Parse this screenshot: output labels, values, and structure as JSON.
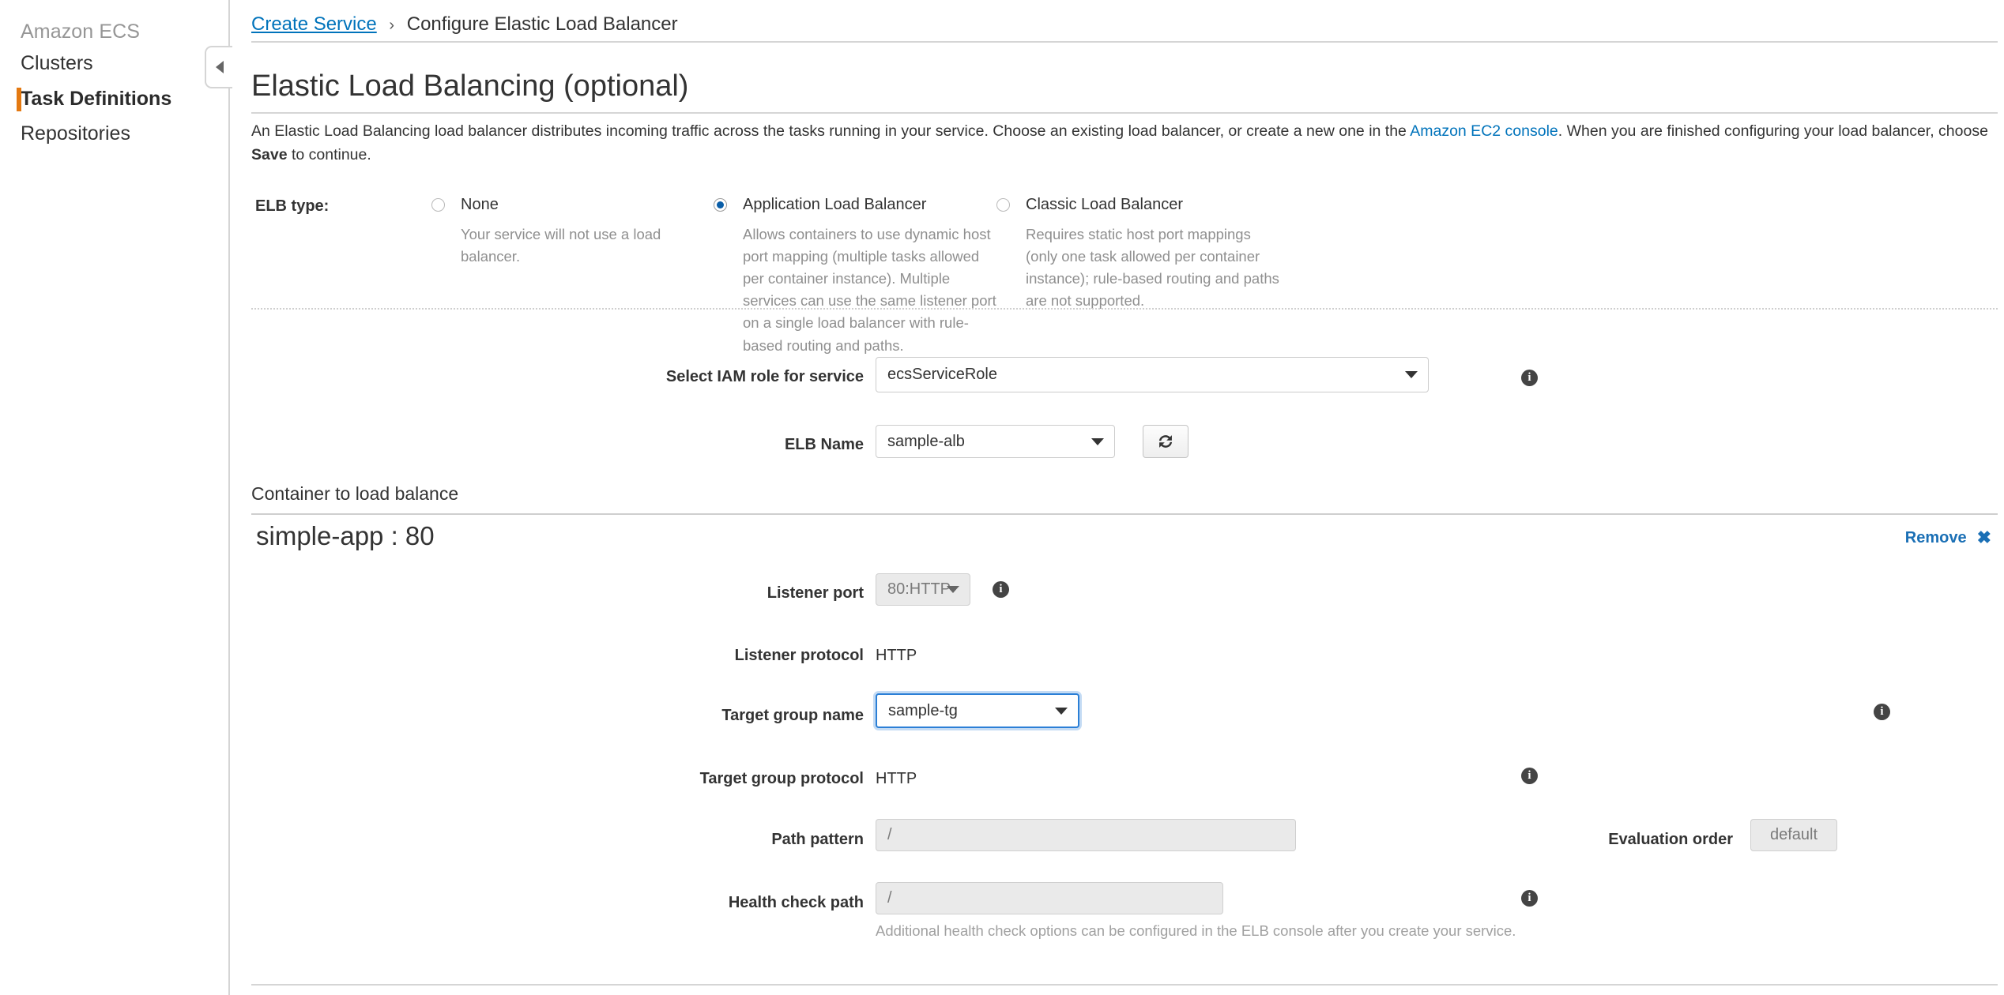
{
  "sidebar": {
    "title": "Amazon ECS",
    "items": [
      {
        "label": "Clusters",
        "active": false
      },
      {
        "label": "Task Definitions",
        "active": true
      },
      {
        "label": "Repositories",
        "active": false
      }
    ],
    "collapse_icon": "chevron-left-icon"
  },
  "breadcrumb": {
    "link": "Create Service",
    "separator": "›",
    "current": "Configure Elastic Load Balancer"
  },
  "page": {
    "heading": "Elastic Load Balancing (optional)",
    "intro_1": "An Elastic Load Balancing load balancer distributes incoming traffic across the tasks running in your service. Choose an existing load balancer, or create a new one in the ",
    "intro_link": "Amazon EC2 console",
    "intro_2": ". When you are finished configuring your load balancer, choose ",
    "intro_bold": "Save",
    "intro_3": " to continue."
  },
  "elb_type": {
    "label": "ELB type:",
    "options": [
      {
        "label": "None",
        "description": "Your service will not use a load balancer.",
        "selected": false
      },
      {
        "label": "Application Load Balancer",
        "description": "Allows containers to use dynamic host port mapping (multiple tasks allowed per container instance). Multiple services can use the same listener port on a single load balancer with rule-based routing and paths.",
        "selected": true
      },
      {
        "label": "Classic Load Balancer",
        "description": "Requires static host port mappings (only one task allowed per container instance); rule-based routing and paths are not supported.",
        "selected": false
      }
    ]
  },
  "form": {
    "iam_role": {
      "label": "Select IAM role for service",
      "value": "ecsServiceRole"
    },
    "elb_name": {
      "label": "ELB Name",
      "value": "sample-alb"
    },
    "refresh_icon": "refresh-icon"
  },
  "container_section": {
    "sub_heading": "Container to load balance",
    "title": "simple-app : 80",
    "remove_label": "Remove",
    "remove_icon": "✖",
    "rows": {
      "listener_port": {
        "label": "Listener port",
        "value": "80:HTTP"
      },
      "listener_protocol": {
        "label": "Listener protocol",
        "value": "HTTP"
      },
      "target_group_name": {
        "label": "Target group name",
        "value": "sample-tg"
      },
      "target_group_protocol": {
        "label": "Target group protocol",
        "value": "HTTP"
      },
      "path_pattern": {
        "label": "Path pattern",
        "value": "/"
      },
      "evaluation_order": {
        "label": "Evaluation order",
        "value": "default"
      },
      "health_check_path": {
        "label": "Health check path",
        "value": "/"
      }
    },
    "health_check_note": "Additional health check options can be configured in the ELB console after you create your service."
  },
  "colors": {
    "link": "#0073bb",
    "accent_orange": "#e47911",
    "radio_selected": "#0a5ea8",
    "focus_ring": "#2b7fd6"
  }
}
